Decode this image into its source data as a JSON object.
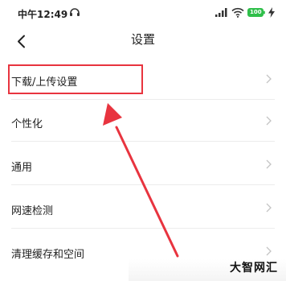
{
  "status_bar": {
    "time": "中午12:49",
    "battery": "100",
    "icons": [
      "headphones-icon",
      "signal-icon",
      "wifi-icon",
      "battery-icon",
      "charge-icon"
    ]
  },
  "header": {
    "title": "设置",
    "back_icon": "chevron-left-icon"
  },
  "settings": {
    "items": [
      {
        "label": "下载/上传设置"
      },
      {
        "label": "个性化"
      },
      {
        "label": "通用"
      },
      {
        "label": "网速检测"
      },
      {
        "label": "清理缓存和空间"
      }
    ]
  },
  "annotation": {
    "color": "#e8343f"
  },
  "watermark": "大智网汇"
}
